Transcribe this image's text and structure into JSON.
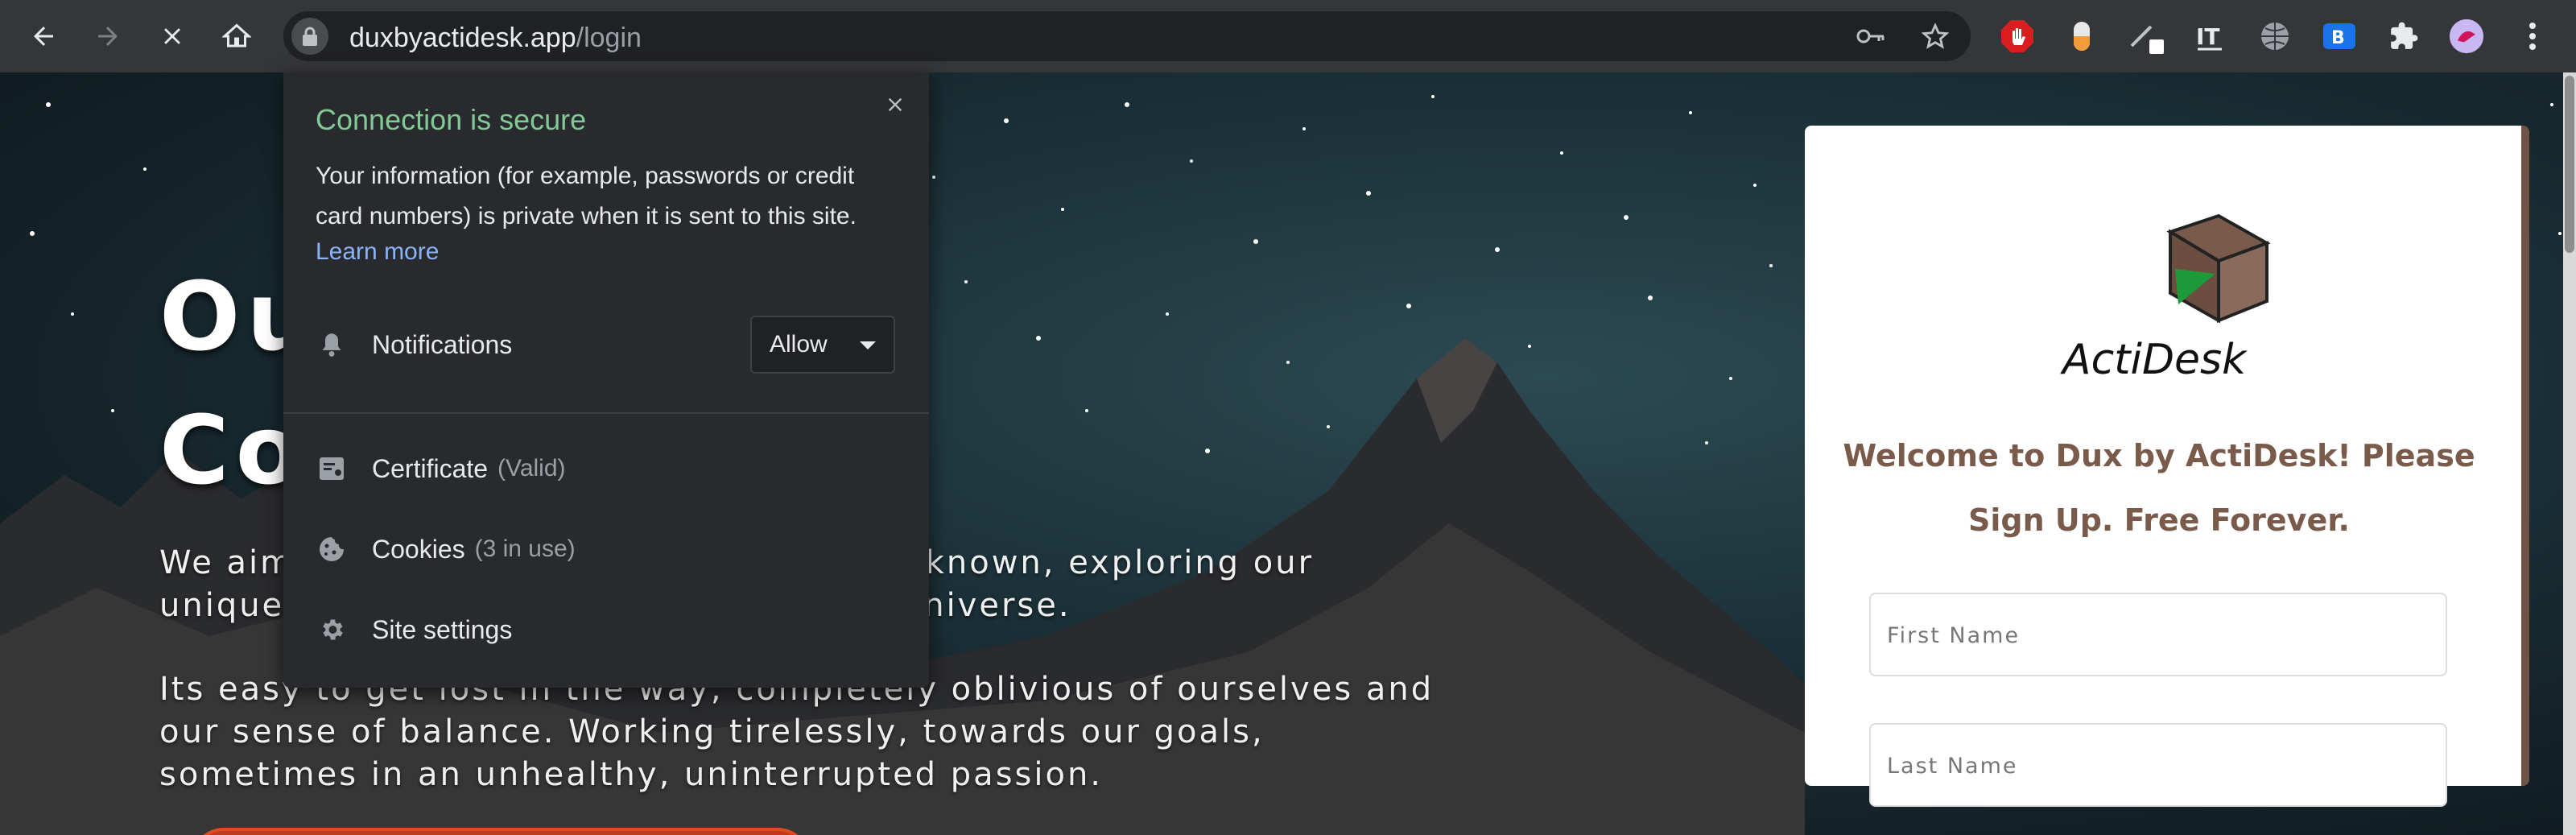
{
  "browser": {
    "url_host": "duxbyactidesk.app",
    "url_path": "/login",
    "icons": [
      "back-icon",
      "forward-icon",
      "stop-loading-icon",
      "home-icon",
      "lock-icon",
      "key-icon",
      "star-icon",
      "puzzle-icon",
      "menu-icon"
    ]
  },
  "hero": {
    "title_line1": "Our Goal Is",
    "title_line2": "Co",
    "paragraph1": "We aim to help the world navigate the unknown, exploring our unique existence in this vast and weird Universe.",
    "paragraph2": "Its easy to get lost in the way, completely oblivious of ourselves and our sense of balance. Working tirelessly, towards our goals, sometimes in an unhealthy, uninterrupted passion."
  },
  "signup": {
    "logo_text": "ActiDesk",
    "welcome": "Welcome to Dux by ActiDesk! Please Sign Up. Free Forever.",
    "first_name_placeholder": "First Name",
    "last_name_placeholder": "Last Name"
  },
  "site_info": {
    "title": "Connection is secure",
    "description": "Your information (for example, passwords or credit card numbers) is private when it is sent to this site.",
    "learn_more": "Learn more",
    "notifications_label": "Notifications",
    "notifications_value": "Allow",
    "certificate_label": "Certificate",
    "certificate_status": "(Valid)",
    "cookies_label": "Cookies",
    "cookies_status": "(3 in use)",
    "site_settings_label": "Site settings"
  },
  "colors": {
    "chrome_bg": "#35363a",
    "secure_green": "#81c995",
    "link_blue": "#8ab4f8",
    "brand_brown": "#7a5a4a"
  }
}
